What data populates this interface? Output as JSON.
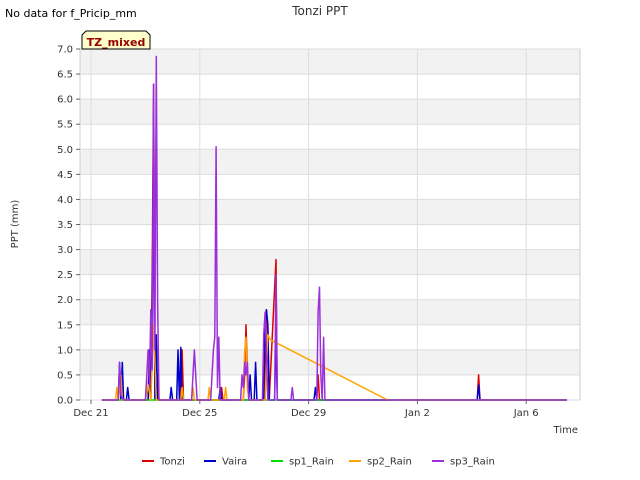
{
  "header": {
    "no_data_note": "No data for f_Pricip_mm",
    "site_badge": "TZ_mixed"
  },
  "chart_data": {
    "type": "line",
    "title": "Tonzi PPT",
    "xlabel": "Time",
    "ylabel": "PPT (mm)",
    "ylim": [
      0,
      7.0
    ],
    "yticks": [
      0.0,
      0.5,
      1.0,
      1.5,
      2.0,
      2.5,
      3.0,
      3.5,
      4.0,
      4.5,
      5.0,
      5.5,
      6.0,
      6.5,
      7.0
    ],
    "ytick_labels": [
      "0.0",
      "0.5",
      "1.0",
      "1.5",
      "2.0",
      "2.5",
      "3.0",
      "3.5",
      "4.0",
      "4.5",
      "5.0",
      "5.5",
      "6.0",
      "6.5",
      "7.0"
    ],
    "xlim_days": [
      0,
      17.5
    ],
    "xticks": [
      {
        "label": "Dec 21",
        "day": 0
      },
      {
        "label": "Dec 25",
        "day": 4
      },
      {
        "label": "Dec 29",
        "day": 8
      },
      {
        "label": "Jan 2",
        "day": 12
      },
      {
        "label": "Jan 6",
        "day": 16
      }
    ],
    "grid": true,
    "legend_position": "bottom",
    "series": [
      {
        "name": "Tonzi",
        "color": "#dd0000",
        "points": [
          [
            0.4,
            0
          ],
          [
            1.0,
            0
          ],
          [
            1.1,
            0.5
          ],
          [
            1.15,
            0
          ],
          [
            2.1,
            0
          ],
          [
            2.15,
            1.0
          ],
          [
            2.2,
            0
          ],
          [
            2.25,
            2.5
          ],
          [
            2.3,
            6.3
          ],
          [
            2.35,
            0.5
          ],
          [
            2.4,
            0
          ],
          [
            2.45,
            0.5
          ],
          [
            2.5,
            0
          ],
          [
            3.0,
            0
          ],
          [
            3.3,
            0
          ],
          [
            3.35,
            1.0
          ],
          [
            3.4,
            0
          ],
          [
            4.7,
            0
          ],
          [
            4.8,
            0.25
          ],
          [
            4.85,
            0
          ],
          [
            5.6,
            0
          ],
          [
            5.65,
            0.5
          ],
          [
            5.7,
            1.5
          ],
          [
            5.75,
            0.5
          ],
          [
            5.8,
            0
          ],
          [
            6.4,
            0
          ],
          [
            6.45,
            1.8
          ],
          [
            6.5,
            1.5
          ],
          [
            6.55,
            0
          ],
          [
            6.8,
            2.8
          ],
          [
            6.85,
            0
          ],
          [
            8.3,
            0
          ],
          [
            8.35,
            0.5
          ],
          [
            8.4,
            0
          ],
          [
            14.2,
            0
          ],
          [
            14.25,
            0.5
          ],
          [
            14.3,
            0
          ],
          [
            17.5,
            0
          ]
        ]
      },
      {
        "name": "Vaira",
        "color": "#0000cc",
        "points": [
          [
            0.4,
            0
          ],
          [
            1.0,
            0
          ],
          [
            1.05,
            0.75
          ],
          [
            1.1,
            0
          ],
          [
            1.15,
            0.75
          ],
          [
            1.2,
            0
          ],
          [
            1.3,
            0
          ],
          [
            1.35,
            0.25
          ],
          [
            1.4,
            0
          ],
          [
            2.1,
            0
          ],
          [
            2.15,
            1.0
          ],
          [
            2.2,
            0
          ],
          [
            2.25,
            1.5
          ],
          [
            2.3,
            5.7
          ],
          [
            2.35,
            0
          ],
          [
            2.4,
            1.3
          ],
          [
            2.45,
            0
          ],
          [
            2.9,
            0
          ],
          [
            2.95,
            0.25
          ],
          [
            3.0,
            0
          ],
          [
            3.15,
            0
          ],
          [
            3.2,
            1.0
          ],
          [
            3.25,
            0
          ],
          [
            3.3,
            1.05
          ],
          [
            3.35,
            0
          ],
          [
            4.7,
            0
          ],
          [
            4.75,
            0.25
          ],
          [
            4.8,
            0
          ],
          [
            5.8,
            0
          ],
          [
            5.85,
            0.5
          ],
          [
            5.9,
            0
          ],
          [
            6.0,
            0
          ],
          [
            6.05,
            0.75
          ],
          [
            6.1,
            0
          ],
          [
            6.35,
            0
          ],
          [
            6.4,
            1.5
          ],
          [
            6.45,
            1.8
          ],
          [
            6.5,
            1.5
          ],
          [
            6.55,
            0
          ],
          [
            6.75,
            0
          ],
          [
            6.8,
            1.4
          ],
          [
            6.85,
            0
          ],
          [
            8.2,
            0
          ],
          [
            8.25,
            0.25
          ],
          [
            8.3,
            0
          ],
          [
            14.2,
            0
          ],
          [
            14.25,
            0.3
          ],
          [
            14.3,
            0
          ],
          [
            17.5,
            0
          ]
        ]
      },
      {
        "name": "sp1_Rain",
        "color": "#00dd00",
        "points": [
          [
            0.4,
            0
          ],
          [
            17.5,
            0
          ]
        ]
      },
      {
        "name": "sp2_Rain",
        "color": "#ffa500",
        "points": [
          [
            0.4,
            0
          ],
          [
            0.9,
            0
          ],
          [
            0.95,
            0.25
          ],
          [
            1.0,
            0
          ],
          [
            1.1,
            0.5
          ],
          [
            1.15,
            0
          ],
          [
            2.0,
            0
          ],
          [
            2.1,
            0.3
          ],
          [
            2.2,
            0
          ],
          [
            2.3,
            1.5
          ],
          [
            2.4,
            0
          ],
          [
            3.3,
            0
          ],
          [
            3.35,
            0.25
          ],
          [
            3.4,
            0
          ],
          [
            3.7,
            0
          ],
          [
            3.75,
            0.25
          ],
          [
            3.8,
            0
          ],
          [
            4.3,
            0
          ],
          [
            4.35,
            0.25
          ],
          [
            4.4,
            0
          ],
          [
            4.9,
            0
          ],
          [
            4.95,
            0.25
          ],
          [
            5.0,
            0
          ],
          [
            5.6,
            0
          ],
          [
            5.65,
            1.0
          ],
          [
            5.7,
            1.25
          ],
          [
            5.75,
            0.25
          ],
          [
            5.8,
            0
          ],
          [
            6.4,
            0
          ],
          [
            6.5,
            1.3
          ],
          [
            6.6,
            1.2
          ],
          [
            10.9,
            0
          ],
          [
            17.5,
            0
          ]
        ]
      },
      {
        "name": "sp3_Rain",
        "color": "#9b30d9",
        "points": [
          [
            0.4,
            0
          ],
          [
            1.0,
            0
          ],
          [
            1.05,
            0.75
          ],
          [
            1.1,
            0.1
          ],
          [
            1.2,
            0
          ],
          [
            2.0,
            0
          ],
          [
            2.05,
            0.5
          ],
          [
            2.1,
            1.0
          ],
          [
            2.15,
            0.3
          ],
          [
            2.2,
            1.8
          ],
          [
            2.25,
            0.6
          ],
          [
            2.3,
            6.3
          ],
          [
            2.35,
            1.0
          ],
          [
            2.4,
            6.85
          ],
          [
            2.45,
            2.0
          ],
          [
            2.5,
            0
          ],
          [
            3.7,
            0
          ],
          [
            3.75,
            0.5
          ],
          [
            3.8,
            1.0
          ],
          [
            3.85,
            0.5
          ],
          [
            3.9,
            0
          ],
          [
            4.4,
            0
          ],
          [
            4.5,
            1.0
          ],
          [
            4.55,
            1.25
          ],
          [
            4.6,
            5.05
          ],
          [
            4.65,
            0.25
          ],
          [
            4.7,
            1.25
          ],
          [
            4.75,
            0
          ],
          [
            5.5,
            0
          ],
          [
            5.55,
            0.5
          ],
          [
            5.6,
            0.25
          ],
          [
            5.65,
            0.75
          ],
          [
            5.7,
            0.5
          ],
          [
            5.75,
            0.75
          ],
          [
            5.8,
            0
          ],
          [
            6.3,
            0
          ],
          [
            6.35,
            1.3
          ],
          [
            6.4,
            1.75
          ],
          [
            6.45,
            1.0
          ],
          [
            6.5,
            0
          ],
          [
            6.75,
            0
          ],
          [
            6.8,
            2.5
          ],
          [
            6.85,
            0
          ],
          [
            7.35,
            0
          ],
          [
            7.4,
            0.25
          ],
          [
            7.45,
            0
          ],
          [
            8.3,
            0
          ],
          [
            8.35,
            1.75
          ],
          [
            8.4,
            2.25
          ],
          [
            8.45,
            0.5
          ],
          [
            8.5,
            0
          ],
          [
            8.55,
            1.25
          ],
          [
            8.6,
            0
          ],
          [
            17.5,
            0
          ]
        ]
      }
    ]
  }
}
